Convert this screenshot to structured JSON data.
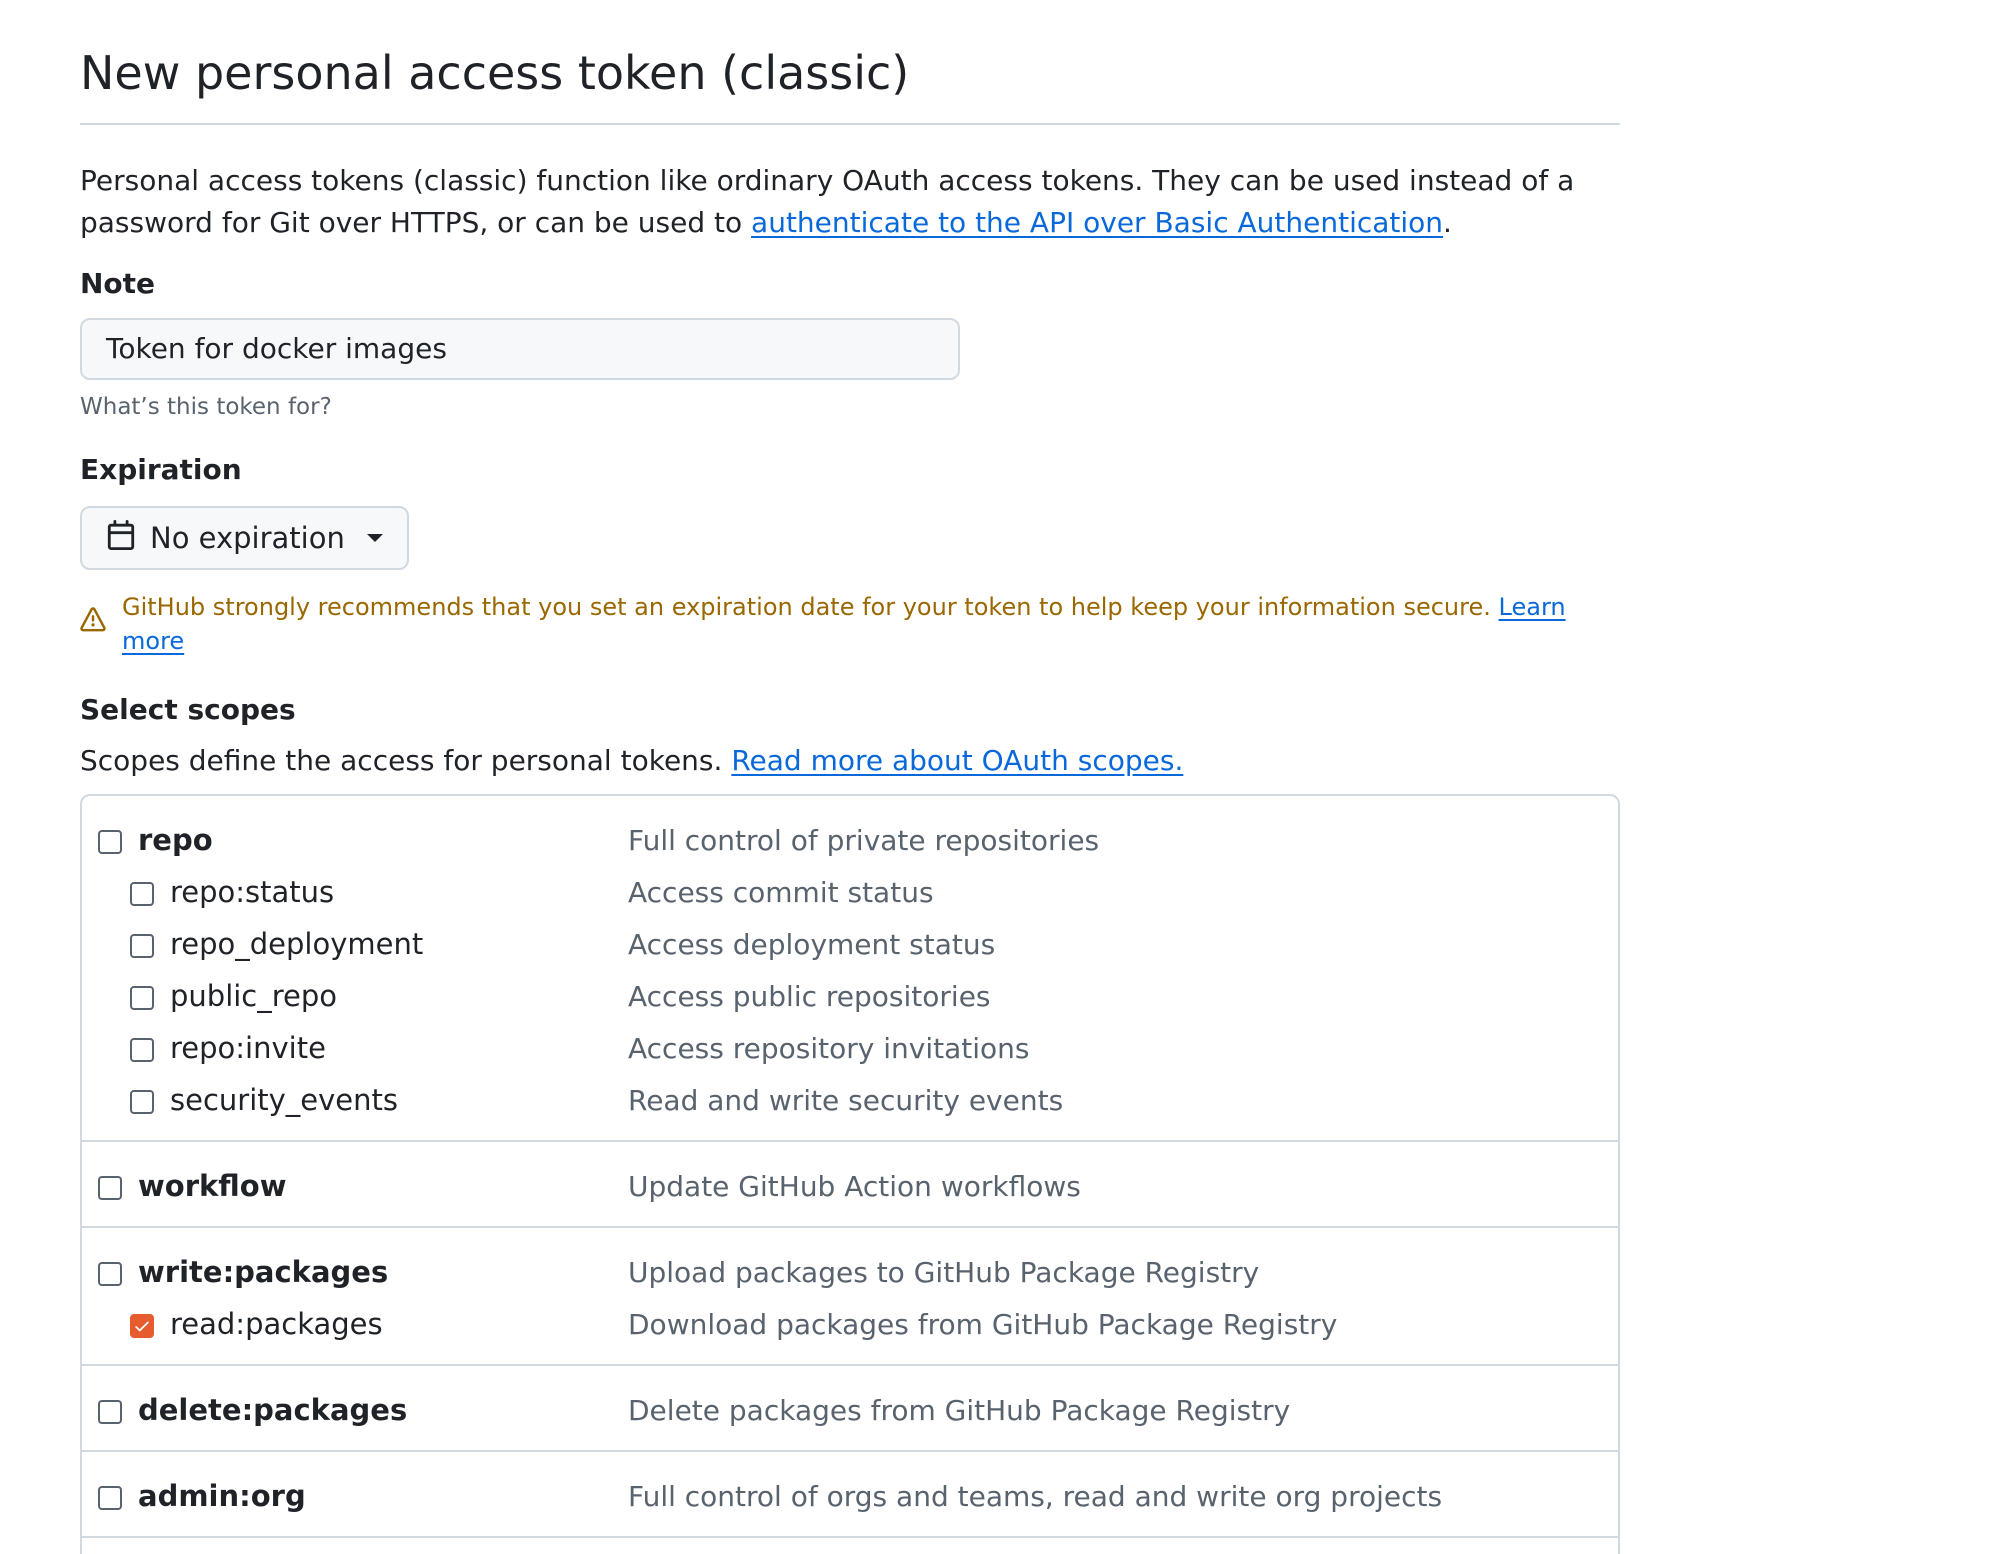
{
  "title": "New personal access token (classic)",
  "intro": {
    "text": "Personal access tokens (classic) function like ordinary OAuth access tokens. They can be used instead of a password for Git over HTTPS, or can be used to ",
    "link": "authenticate to the API over Basic Authentication",
    "suffix": "."
  },
  "note": {
    "label": "Note",
    "value": "Token for docker images",
    "hint": "What’s this token for?"
  },
  "expiration": {
    "label": "Expiration",
    "selected": "No expiration",
    "warning": "GitHub strongly recommends that you set an expiration date for your token to help keep your information secure.",
    "learn_more": "Learn more",
    "warning_color": "#9a6700"
  },
  "scopes": {
    "label": "Select scopes",
    "desc": "Scopes define the access for personal tokens.",
    "link": "Read more about OAuth scopes.",
    "groups": [
      {
        "parent": {
          "name": "repo",
          "desc": "Full control of private repositories",
          "checked": false
        },
        "children": [
          {
            "name": "repo:status",
            "desc": "Access commit status",
            "checked": false
          },
          {
            "name": "repo_deployment",
            "desc": "Access deployment status",
            "checked": false
          },
          {
            "name": "public_repo",
            "desc": "Access public repositories",
            "checked": false
          },
          {
            "name": "repo:invite",
            "desc": "Access repository invitations",
            "checked": false
          },
          {
            "name": "security_events",
            "desc": "Read and write security events",
            "checked": false
          }
        ]
      },
      {
        "parent": {
          "name": "workflow",
          "desc": "Update GitHub Action workflows",
          "checked": false
        },
        "children": []
      },
      {
        "parent": {
          "name": "write:packages",
          "desc": "Upload packages to GitHub Package Registry",
          "checked": false
        },
        "children": [
          {
            "name": "read:packages",
            "desc": "Download packages from GitHub Package Registry",
            "checked": true
          }
        ]
      },
      {
        "parent": {
          "name": "delete:packages",
          "desc": "Delete packages from GitHub Package Registry",
          "checked": false
        },
        "children": []
      },
      {
        "parent": {
          "name": "admin:org",
          "desc": "Full control of orgs and teams, read and write org projects",
          "checked": false
        },
        "children": []
      }
    ]
  },
  "colors": {
    "link": "#0969da",
    "checked": "#e65c2e",
    "border": "#d1d9e0",
    "muted": "#59636e"
  }
}
